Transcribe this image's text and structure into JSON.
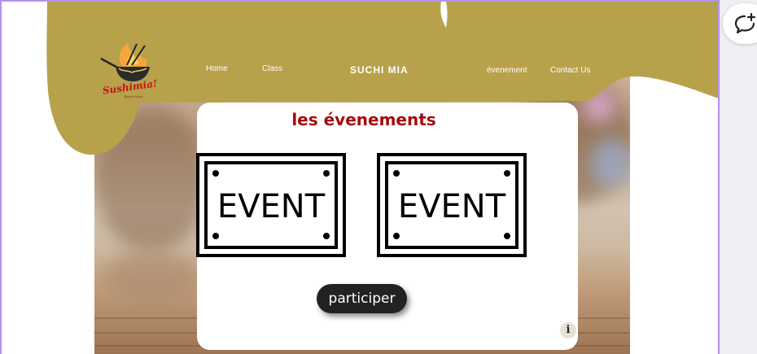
{
  "logo": {
    "text": "Sushimia!",
    "tagline": "Best in Sushi"
  },
  "nav": {
    "home": "Home",
    "class": "Class",
    "brand": "SUCHI MIA",
    "evenement": "évenement",
    "contact": "Contact Us"
  },
  "section": {
    "title": "les évenements"
  },
  "events": [
    {
      "label": "EVENT"
    },
    {
      "label": "EVENT"
    }
  ],
  "actions": {
    "participate": "participer",
    "info": "i"
  },
  "colors": {
    "header_gold": "#b7a14b",
    "title_red": "#a60b0b",
    "button_dark": "#222222",
    "frame_purple": "#b493f0"
  },
  "icons": {
    "comment_add": "comment-add-icon",
    "info": "info-icon",
    "logo": "wok-chopsticks-logo"
  }
}
